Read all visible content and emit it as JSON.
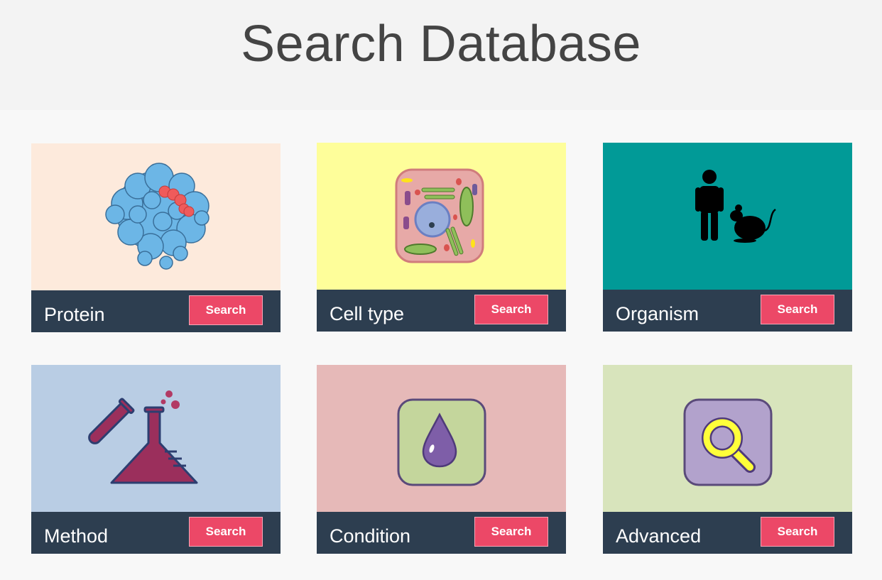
{
  "page": {
    "title": "Search Database"
  },
  "cards": [
    {
      "label": "Protein",
      "button": "Search",
      "bg": "#fdeadc",
      "icon": "protein-structure-icon"
    },
    {
      "label": "Cell type",
      "button": "Search",
      "bg": "#fefe9a",
      "icon": "cell-icon"
    },
    {
      "label": "Organism",
      "button": "Search",
      "bg": "#019a97",
      "icon": "human-and-mouse-icon"
    },
    {
      "label": "Method",
      "button": "Search",
      "bg": "#b9cde4",
      "icon": "test-tube-flask-icon"
    },
    {
      "label": "Condition",
      "button": "Search",
      "bg": "#e6b9b8",
      "icon": "droplet-icon"
    },
    {
      "label": "Advanced",
      "button": "Search",
      "bg": "#d8e4bc",
      "icon": "magnifier-icon"
    }
  ],
  "colors": {
    "header_bg": "#f3f3f3",
    "bar_bg": "#2d3e50",
    "button_bg": "#ec4867"
  }
}
